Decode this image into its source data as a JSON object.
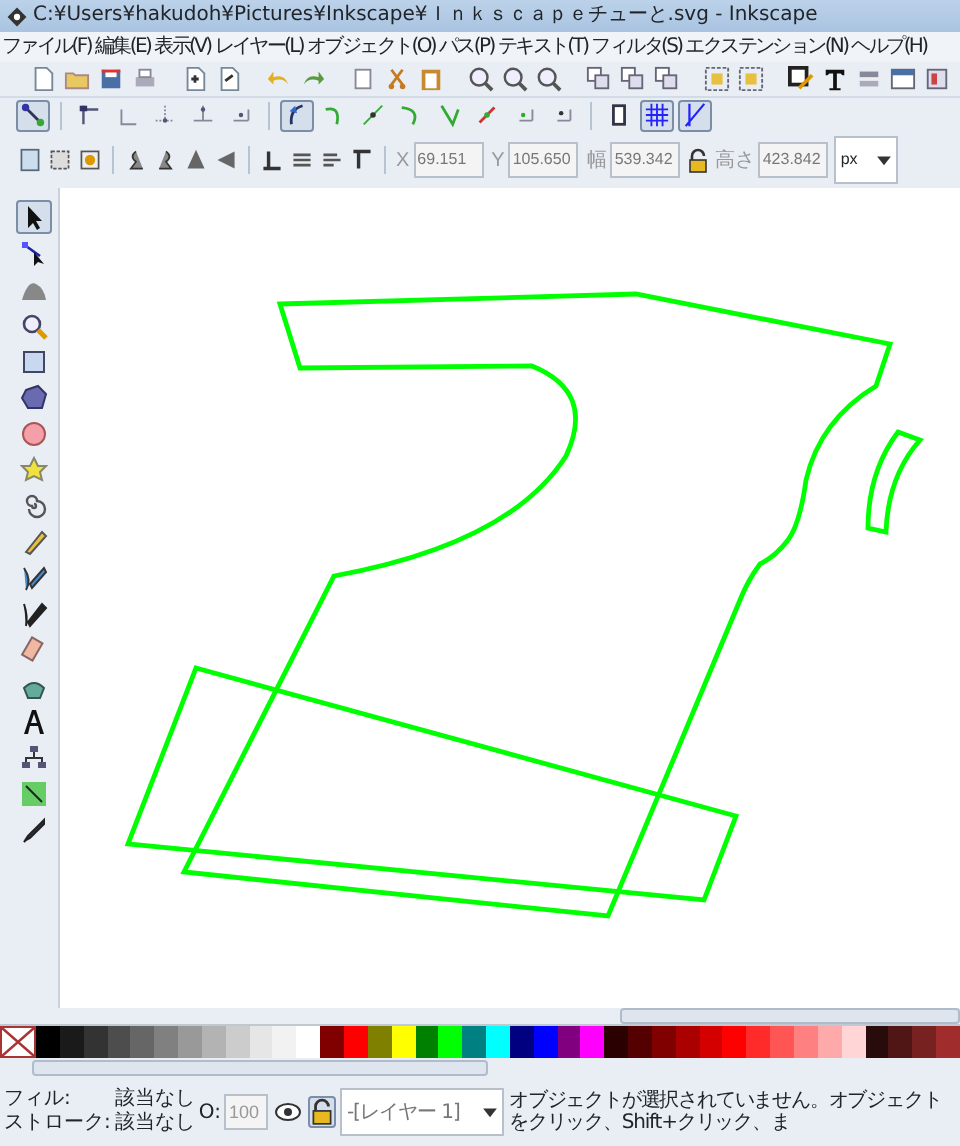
{
  "window": {
    "title": "C:¥Users¥hakudoh¥Pictures¥Inkscape¥Ｉｎｋｓｃａｐｅチューと.svg - Inkscape"
  },
  "menu": [
    "ファイル(F)",
    "編集(E)",
    "表示(V)",
    "レイヤー(L)",
    "オブジェクト(O)",
    "パス(P)",
    "テキスト(T)",
    "フィルタ(S)",
    "エクステンション(N)",
    "ヘルプ(H)"
  ],
  "snap_toolbar": [
    {
      "on": true
    },
    {
      "on": false
    },
    {
      "on": false
    },
    {
      "on": false
    },
    {
      "on": false
    },
    {
      "on": false
    },
    {
      "on": true
    },
    {
      "on": false
    },
    {
      "on": false
    },
    {
      "on": false
    },
    {
      "on": false
    },
    {
      "on": false
    },
    {
      "on": false
    },
    {
      "on": false
    },
    {
      "on": false
    },
    {
      "on": true
    },
    {
      "on": true
    }
  ],
  "select_toolbar": {
    "disabled": true,
    "fields": [
      {
        "label": "X",
        "value": "69.151"
      },
      {
        "label": "Y",
        "value": "105.650"
      },
      {
        "label": "幅",
        "value": "539.342"
      },
      {
        "label": "高さ",
        "value": "423.842"
      }
    ],
    "unit": "px"
  },
  "toolbox": [
    {
      "selected": true
    },
    {
      "selected": false
    },
    {
      "selected": false
    },
    {
      "selected": false
    },
    {
      "selected": false
    },
    {
      "selected": false
    },
    {
      "selected": false
    },
    {
      "selected": false
    },
    {
      "selected": false
    },
    {
      "selected": false
    },
    {
      "selected": false
    },
    {
      "selected": false
    },
    {
      "selected": false
    },
    {
      "selected": false
    },
    {
      "selected": false
    },
    {
      "selected": false
    },
    {
      "selected": false
    },
    {
      "selected": false
    }
  ],
  "palette": [
    {
      "color": "#000000"
    },
    {
      "color": "#1a1a1a"
    },
    {
      "color": "#333333"
    },
    {
      "color": "#4d4d4d"
    },
    {
      "color": "#666666"
    },
    {
      "color": "#808080"
    },
    {
      "color": "#999999"
    },
    {
      "color": "#b3b3b3"
    },
    {
      "color": "#cccccc"
    },
    {
      "color": "#e6e6e6"
    },
    {
      "color": "#f2f2f2"
    },
    {
      "color": "#ffffff"
    },
    {
      "color": "#800000"
    },
    {
      "color": "#ff0000"
    },
    {
      "color": "#808000"
    },
    {
      "color": "#ffff00"
    },
    {
      "color": "#008000"
    },
    {
      "color": "#00ff00"
    },
    {
      "color": "#008080"
    },
    {
      "color": "#00ffff"
    },
    {
      "color": "#000080"
    },
    {
      "color": "#0000ff"
    },
    {
      "color": "#800080"
    },
    {
      "color": "#ff00ff"
    },
    {
      "color": "#2b0000"
    },
    {
      "color": "#550000"
    },
    {
      "color": "#800000"
    },
    {
      "color": "#aa0000"
    },
    {
      "color": "#d40000"
    },
    {
      "color": "#ff0000"
    },
    {
      "color": "#ff2a2a"
    },
    {
      "color": "#ff5555"
    },
    {
      "color": "#ff8080"
    },
    {
      "color": "#ffaaaa"
    },
    {
      "color": "#ffd5d5"
    },
    {
      "color": "#280b0b"
    },
    {
      "color": "#501616"
    },
    {
      "color": "#782121"
    },
    {
      "color": "#a02c2c"
    }
  ],
  "status_bar": {
    "fill_label": "フィル:",
    "fill_value": "該当なし",
    "stroke_label": "ストローク:",
    "stroke_value": "該当なし",
    "opacity_label": "O:",
    "opacity_value": "100",
    "layer": "-[レイヤー 1]",
    "message": "オブジェクトが選択されていません。オブジェクトをクリック、Shift+クリック、ま"
  }
}
